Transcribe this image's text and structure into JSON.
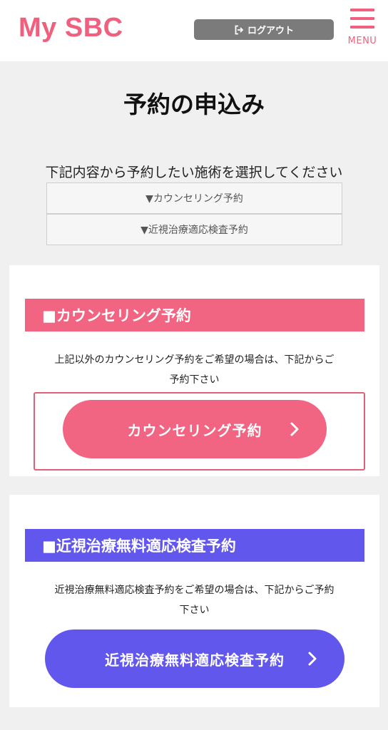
{
  "header": {
    "logo": "My SBC",
    "logout_label": "ログアウト",
    "menu_label": "MENU"
  },
  "page": {
    "title": "予約の申込み",
    "intro": "下記内容から予約したい施術を選択してください",
    "anchors": [
      "▼カウンセリング予約",
      "▼近視治療適応検査予約"
    ]
  },
  "sections": [
    {
      "heading": "■カウンセリング予約",
      "description_lines": [
        "上記以外のカウンセリング予約をご希望の場合は、下記からご",
        "予約下さい"
      ],
      "button_label": "カウンセリング予約"
    },
    {
      "heading": "■近視治療無料適応検査予約",
      "description_lines": [
        "近視治療無料適応検査予約をご希望の場合は、下記からご予約",
        "下さい"
      ],
      "button_label": "近視治療無料適応検査予約"
    }
  ],
  "colors": {
    "brand_pink": "#f26582",
    "brand_blue": "#6257ec",
    "logout_gray": "#7b7b7b"
  },
  "icons": {
    "logout": "logout-icon",
    "menu": "hamburger-icon",
    "chevron": "chevron-right-icon"
  }
}
